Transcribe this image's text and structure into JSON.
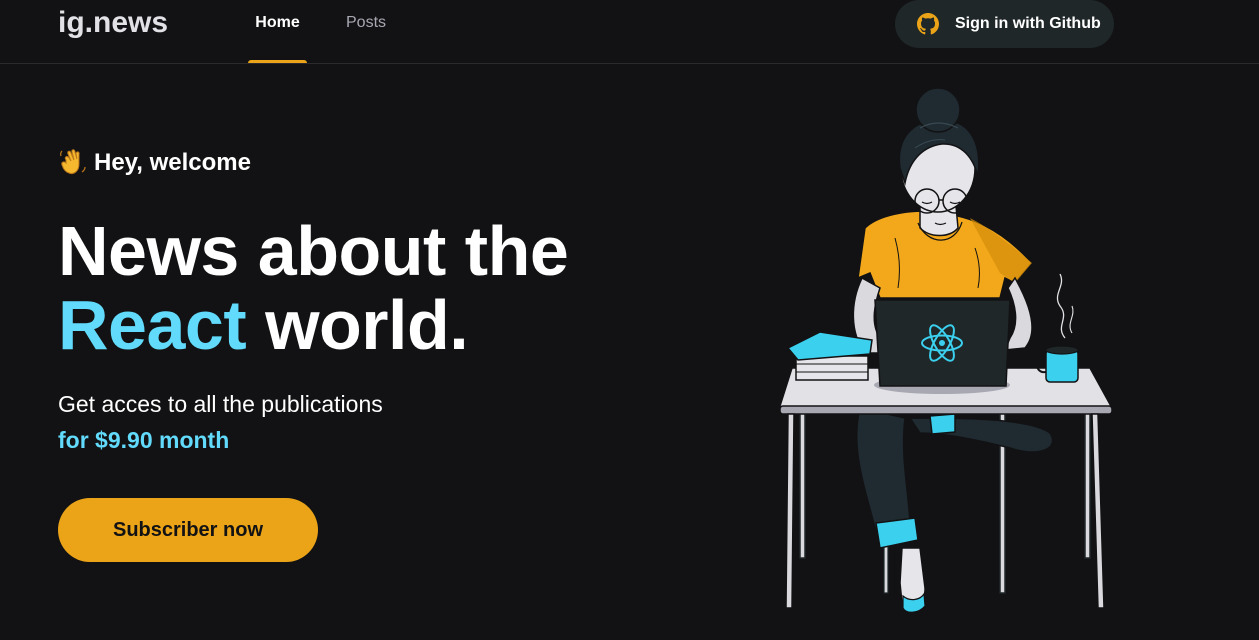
{
  "header": {
    "logo": "ig.news",
    "nav": [
      {
        "label": "Home",
        "active": true
      },
      {
        "label": "Posts",
        "active": false
      }
    ],
    "signin_label": "Sign in with Github",
    "github_icon_color": "#eba417"
  },
  "hero": {
    "welcome_emoji": "waving-hand-icon",
    "welcome_text": "Hey, welcome",
    "headline_line1": "News about the",
    "headline_accent": "React",
    "headline_rest": " world.",
    "description": "Get acces to all the publications",
    "price": "for $9.90 month",
    "cta_label": "Subscriber now"
  },
  "illustration": {
    "name": "woman-with-laptop-illustration",
    "laptop_logo": "react-logo-icon"
  },
  "colors": {
    "background": "#121214",
    "accent_yellow": "#eba417",
    "accent_cyan": "#61dafb",
    "muted_text": "#a8a8b3",
    "button_dark": "#1f2729"
  }
}
